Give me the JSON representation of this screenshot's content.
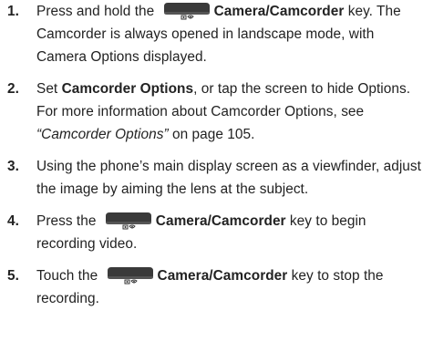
{
  "steps": [
    {
      "number": "1.",
      "text_before": "Press and hold the",
      "key_name": "Camera/Camcorder",
      "text_after": " key. The Camcorder is always opened in landscape mode, with Camera Options displayed."
    },
    {
      "number": "2.",
      "text_before": "Set ",
      "bold": "Camcorder Options",
      "text_middle": ", or tap the screen to hide Options. For more information about Camcorder Options, see ",
      "italic_ref": "“Camcorder Options”",
      "text_after": " on page 105."
    },
    {
      "number": "3.",
      "text": "Using the phone’s main display screen as a viewfinder, adjust the image by aiming the lens at the subject."
    },
    {
      "number": "4.",
      "text_before": "Press the",
      "key_name": "Camera/Camcorder",
      "text_after": " key to begin recording video."
    },
    {
      "number": "5.",
      "text_before": "Touch the",
      "key_name": "Camera/Camcorder",
      "text_after": " key to stop the recording."
    }
  ],
  "icon": "camera-camcorder-key-icon",
  "colors": {
    "text": "#222222",
    "key_body": "#3a3a3a"
  }
}
